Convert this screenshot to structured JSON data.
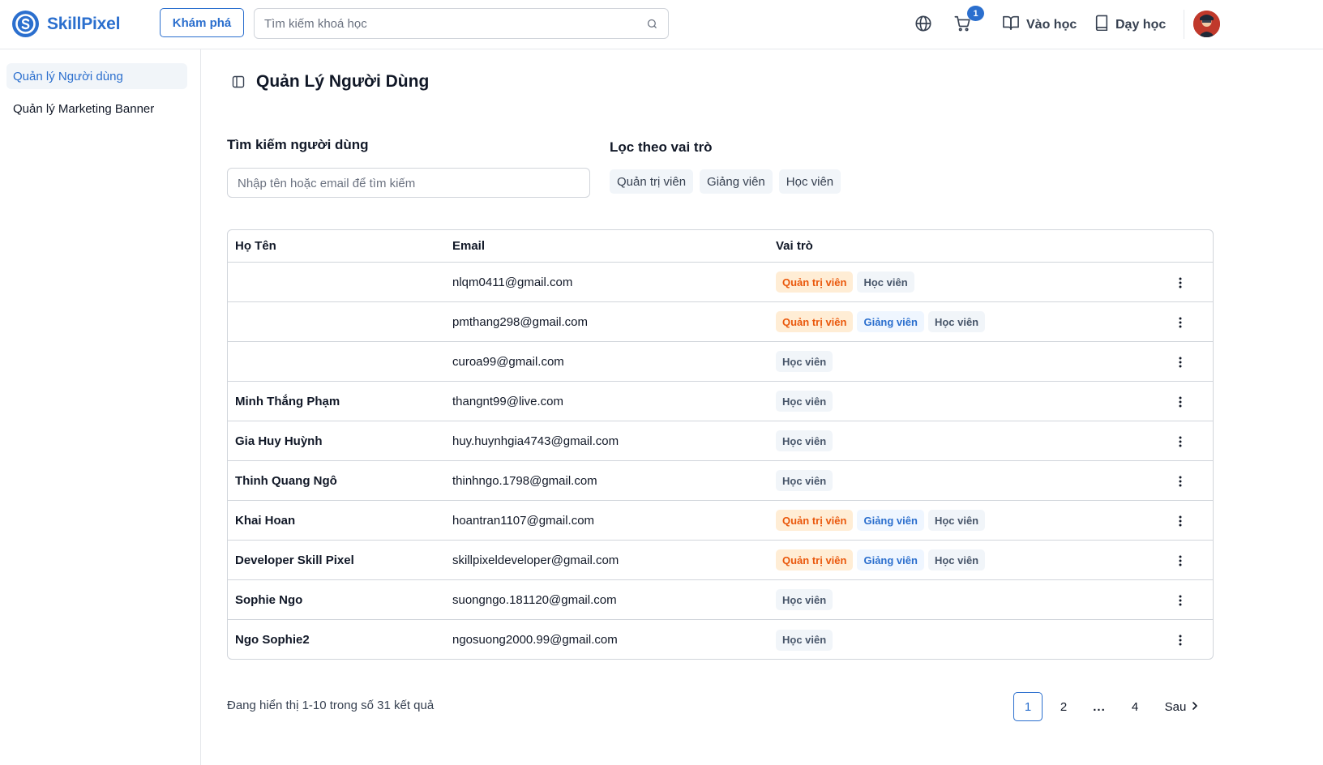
{
  "header": {
    "brand": "SkillPixel",
    "explore_label": "Khám phá",
    "search_placeholder": "Tìm kiếm khoá học",
    "cart_count": "1",
    "learn_label": "Vào học",
    "teach_label": "Dạy học"
  },
  "sidebar": {
    "items": [
      {
        "label": "Quản lý Người dùng",
        "active": true
      },
      {
        "label": "Quản lý Marketing Banner",
        "active": false
      }
    ]
  },
  "main": {
    "title": "Quản Lý Người Dùng",
    "search_label": "Tìm kiếm người dùng",
    "search_placeholder": "Nhập tên hoặc email để tìm kiếm",
    "role_filter_label": "Lọc theo vai trò",
    "role_filters": [
      "Quản trị viên",
      "Giảng viên",
      "Học viên"
    ]
  },
  "table": {
    "headers": {
      "name": "Họ Tên",
      "email": "Email",
      "role": "Vai trò"
    },
    "rows": [
      {
        "name": "",
        "email": "nlqm0411@gmail.com",
        "roles": [
          "Quản trị viên",
          "Học viên"
        ]
      },
      {
        "name": "",
        "email": "pmthang298@gmail.com",
        "roles": [
          "Quản trị viên",
          "Giảng viên",
          "Học viên"
        ]
      },
      {
        "name": "",
        "email": "curoa99@gmail.com",
        "roles": [
          "Học viên"
        ]
      },
      {
        "name": "Minh Thắng Phạm",
        "email": "thangnt99@live.com",
        "roles": [
          "Học viên"
        ]
      },
      {
        "name": "Gia Huy Huỳnh",
        "email": "huy.huynhgia4743@gmail.com",
        "roles": [
          "Học viên"
        ]
      },
      {
        "name": "Thinh Quang Ngô",
        "email": "thinhngo.1798@gmail.com",
        "roles": [
          "Học viên"
        ]
      },
      {
        "name": "Khai Hoan",
        "email": "hoantran1107@gmail.com",
        "roles": [
          "Quản trị viên",
          "Giảng viên",
          "Học viên"
        ]
      },
      {
        "name": "Developer Skill Pixel",
        "email": "skillpixeldeveloper@gmail.com",
        "roles": [
          "Quản trị viên",
          "Giảng viên",
          "Học viên"
        ]
      },
      {
        "name": "Sophie Ngo",
        "email": "suongngo.181120@gmail.com",
        "roles": [
          "Học viên"
        ]
      },
      {
        "name": "Ngo Sophie2",
        "email": "ngosuong2000.99@gmail.com",
        "roles": [
          "Học viên"
        ]
      }
    ]
  },
  "pagination": {
    "summary": "Đang hiển thị 1-10 trong số 31 kết quả",
    "pages": [
      "1",
      "2",
      "...",
      "4"
    ],
    "current": "1",
    "next_label": "Sau"
  },
  "colors": {
    "brand": "#2b6fce",
    "admin_badge_bg": "#ffedd5",
    "admin_badge_text": "#ea580c",
    "teacher_badge_bg": "#eff6ff",
    "teacher_badge_text": "#2b6fce",
    "student_badge_bg": "#f1f5f9",
    "student_badge_text": "#475569"
  },
  "icons": {
    "search": "search-icon",
    "globe": "globe-icon",
    "cart": "cart-icon",
    "learn": "book-open-icon",
    "teach": "book-icon",
    "sidebar_toggle": "sidebar-toggle-icon",
    "row_menu": "more-vertical-icon",
    "next": "chevron-right-icon"
  }
}
